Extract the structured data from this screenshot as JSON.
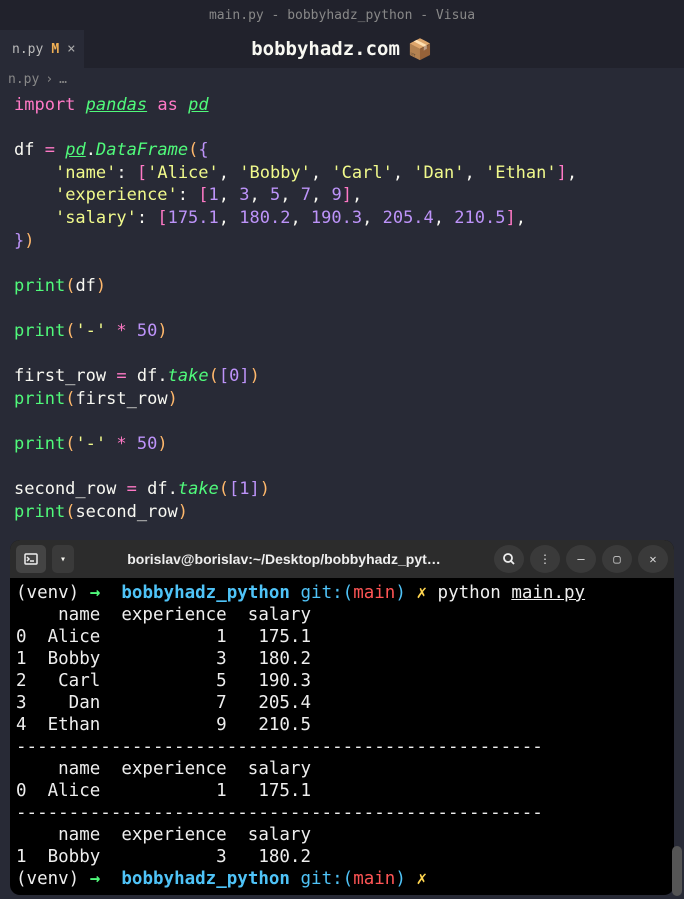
{
  "titlebar": "main.py - bobbyhadz_python - Visua",
  "tab": {
    "file": "n.py",
    "modified": "M"
  },
  "watermark": "bobbyhadz.com",
  "breadcrumb": {
    "file": "n.py",
    "sep": "›",
    "more": "…"
  },
  "code": {
    "l1_import": "import",
    "l1_module": "pandas",
    "l1_as": "as",
    "l1_alias": "pd",
    "l3_var": "df",
    "l3_eq": "=",
    "l3_pd": "pd",
    "l3_df": "DataFrame",
    "l4_key": "'name'",
    "l4_v1": "'Alice'",
    "l4_v2": "'Bobby'",
    "l4_v3": "'Carl'",
    "l4_v4": "'Dan'",
    "l4_v5": "'Ethan'",
    "l5_key": "'experience'",
    "l5_v1": "1",
    "l5_v2": "3",
    "l5_v3": "5",
    "l5_v4": "7",
    "l5_v5": "9",
    "l6_key": "'salary'",
    "l6_v1": "175.1",
    "l6_v2": "180.2",
    "l6_v3": "190.3",
    "l6_v4": "205.4",
    "l6_v5": "210.5",
    "l9_fn": "print",
    "l9_arg": "df",
    "l11_fn": "print",
    "l11_str": "'-'",
    "l11_num": "50",
    "l13_var": "first_row",
    "l13_df": "df",
    "l13_take": "take",
    "l13_idx": "0",
    "l14_fn": "print",
    "l14_arg": "first_row",
    "l16_fn": "print",
    "l16_str": "'-'",
    "l16_num": "50",
    "l18_var": "second_row",
    "l18_df": "df",
    "l18_take": "take",
    "l18_idx": "1",
    "l19_fn": "print",
    "l19_arg": "second_row"
  },
  "terminal": {
    "title": "borislav@borislav:~/Desktop/bobbyhadz_pyt…",
    "prompt": {
      "venv": "(venv)",
      "arrow": "→",
      "dir": "bobbyhadz_python",
      "git_pre": "git:(",
      "branch": "main",
      "git_post": ")",
      "x": "✗"
    },
    "cmd": "python",
    "cmd_file": "main.py",
    "header": "    name  experience  salary",
    "rows": [
      "0  Alice           1   175.1",
      "1  Bobby           3   180.2",
      "2   Carl           5   190.3",
      "3    Dan           7   205.4",
      "4  Ethan           9   210.5"
    ],
    "sep": "--------------------------------------------------",
    "r1_header": "    name  experience  salary",
    "r1_row": "0  Alice           1   175.1",
    "r2_header": "    name  experience  salary",
    "r2_row": "1  Bobby           3   180.2"
  }
}
